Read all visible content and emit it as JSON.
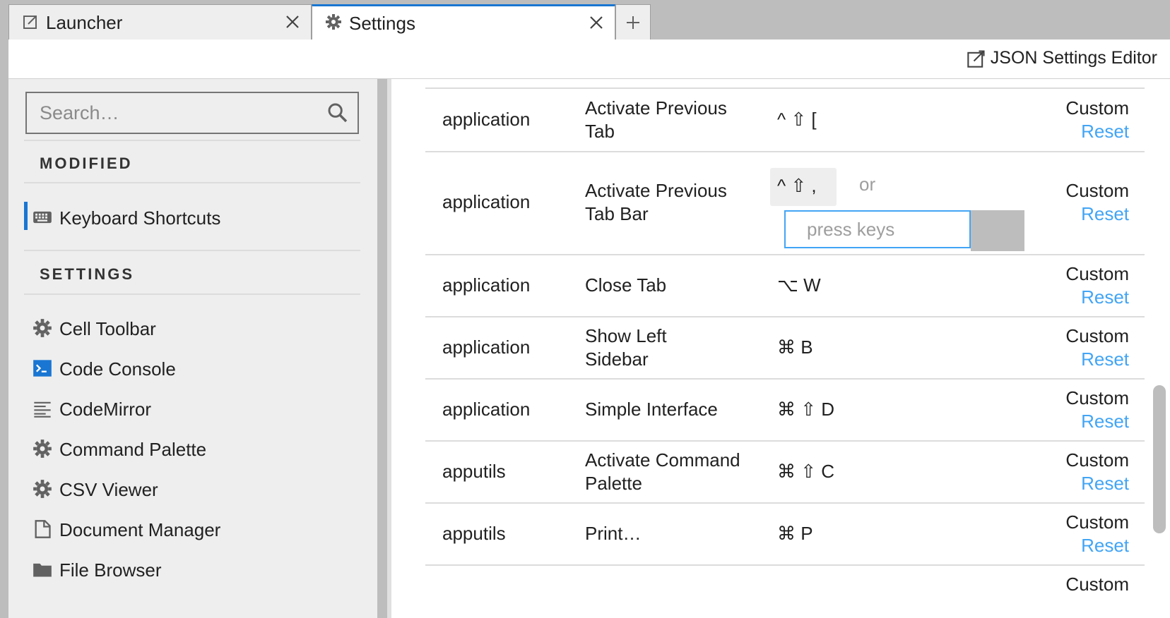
{
  "tabs": [
    {
      "label": "Launcher",
      "icon": "launcher-icon"
    },
    {
      "label": "Settings",
      "icon": "gear-icon"
    }
  ],
  "toolbar": {
    "json_editor_label": "JSON Settings Editor"
  },
  "sidebar": {
    "search_placeholder": "Search…",
    "modified_title": "MODIFIED",
    "settings_title": "SETTINGS",
    "modified_items": [
      {
        "label": "Keyboard Shortcuts",
        "icon": "keyboard-icon"
      }
    ],
    "items": [
      {
        "label": "Cell Toolbar",
        "icon": "gear-icon"
      },
      {
        "label": "Code Console",
        "icon": "console-icon"
      },
      {
        "label": "CodeMirror",
        "icon": "text-lines-icon"
      },
      {
        "label": "Command Palette",
        "icon": "gear-icon"
      },
      {
        "label": "CSV Viewer",
        "icon": "gear-icon"
      },
      {
        "label": "Document Manager",
        "icon": "file-icon"
      },
      {
        "label": "File Browser",
        "icon": "folder-icon"
      }
    ]
  },
  "shortcuts": {
    "rows": [
      {
        "category": "application",
        "command": "Activate Previous Tab",
        "keys": "^ ⇧ [",
        "status": "Custom",
        "reset": "Reset"
      },
      {
        "category": "application",
        "command": "Activate Previous Tab Bar",
        "keys": "^ ⇧ ,",
        "or": "or",
        "press_placeholder": "press keys",
        "status": "Custom",
        "reset": "Reset"
      },
      {
        "category": "application",
        "command": "Close Tab",
        "keys": "⌥ W",
        "status": "Custom",
        "reset": "Reset"
      },
      {
        "category": "application",
        "command": "Show Left Sidebar",
        "keys": "⌘ B",
        "status": "Custom",
        "reset": "Reset"
      },
      {
        "category": "application",
        "command": "Simple Interface",
        "keys": "⌘ ⇧ D",
        "status": "Custom",
        "reset": "Reset"
      },
      {
        "category": "apputils",
        "command": "Activate Command Palette",
        "keys": "⌘ ⇧ C",
        "status": "Custom",
        "reset": "Reset"
      },
      {
        "category": "apputils",
        "command": "Print…",
        "keys": "⌘ P",
        "status": "Custom",
        "reset": "Reset"
      },
      {
        "status": "Custom"
      }
    ]
  },
  "colors": {
    "accent": "#1976d2",
    "link": "#42a5f5",
    "sidebar_bg": "#eeeeee"
  }
}
